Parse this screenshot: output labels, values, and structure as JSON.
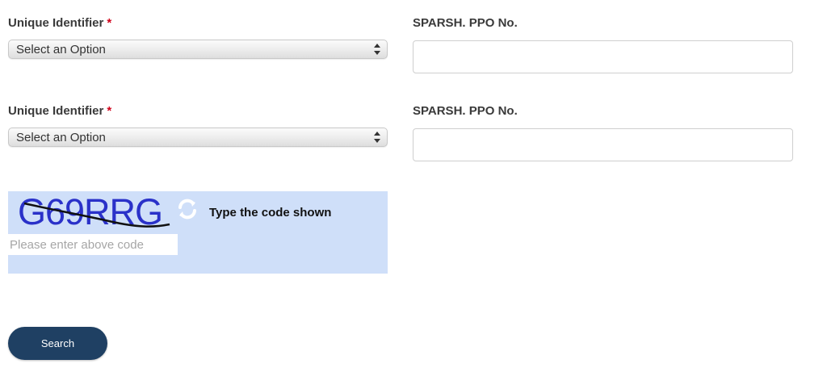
{
  "form": {
    "rows": [
      {
        "identifier_label": "Unique Identifier",
        "required_marker": "*",
        "select_value": "Select an Option",
        "ppo_label": "SPARSH. PPO No.",
        "ppo_value": ""
      },
      {
        "identifier_label": "Unique Identifier",
        "required_marker": "*",
        "select_value": "Select an Option",
        "ppo_label": "SPARSH. PPO No.",
        "ppo_value": ""
      }
    ]
  },
  "captcha": {
    "code": "G69RRG",
    "hint": "Type the code shown",
    "input_placeholder": "Please enter above code",
    "input_value": "",
    "panel_color": "#cfdff9",
    "icons": {
      "refresh": "refresh-icon"
    }
  },
  "actions": {
    "search_label": "Search",
    "button_color": "#1f4063"
  },
  "colors": {
    "required": "#d0021b"
  }
}
